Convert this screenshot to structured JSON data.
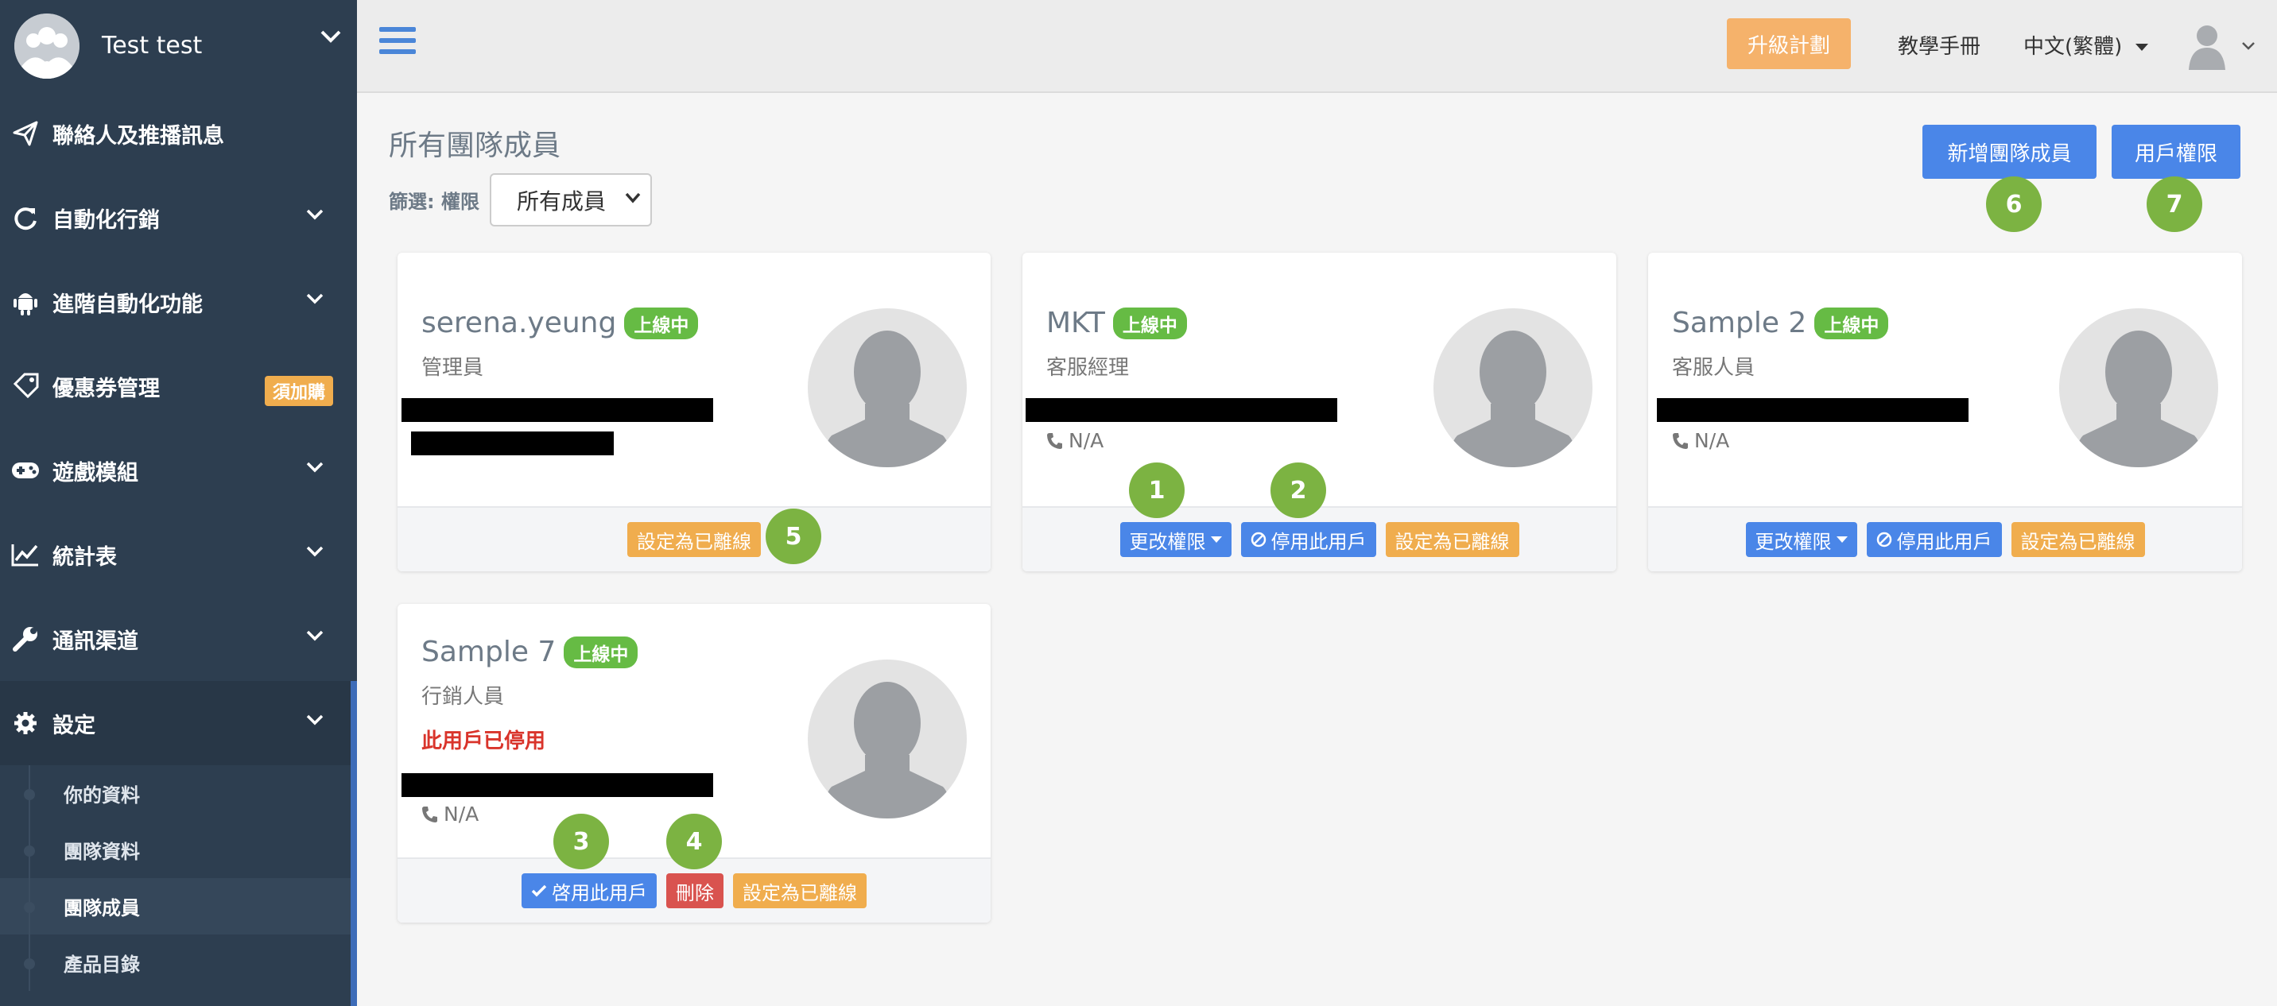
{
  "sidebar": {
    "user_name": "Test test",
    "items": [
      {
        "label": "聯絡人及推播訊息",
        "icon": "paper-plane-icon"
      },
      {
        "label": "自動化行銷",
        "icon": "refresh-icon"
      },
      {
        "label": "進階自動化功能",
        "icon": "android-icon"
      },
      {
        "label": "優惠券管理",
        "icon": "ticket-icon",
        "badge": "須加購"
      },
      {
        "label": "遊戲模組",
        "icon": "gamepad-icon"
      },
      {
        "label": "統計表",
        "icon": "line-chart-icon"
      },
      {
        "label": "通訊渠道",
        "icon": "wrench-icon"
      },
      {
        "label": "設定",
        "icon": "gear-icon"
      }
    ],
    "sub_items": [
      "你的資料",
      "團隊資料",
      "團隊成員",
      "產品目錄"
    ],
    "active_sub": "團隊成員"
  },
  "topbar": {
    "upgrade_label": "升級計劃",
    "manual_label": "教學手冊",
    "language_label": "中文(繁體)"
  },
  "main": {
    "title": "所有團隊成員",
    "filter_label": "篩選: 權限",
    "filter_value": "所有成員",
    "add_member_label": "新增團隊成員",
    "user_permission_label": "用戶權限"
  },
  "members": [
    {
      "name": "serena.yeung",
      "status": "上線中",
      "role": "管理員",
      "actions": [
        "設定為已離線"
      ]
    },
    {
      "name": "MKT",
      "status": "上線中",
      "role": "客服經理",
      "phone": "N/A",
      "actions": [
        "更改權限",
        "停用此用戶",
        "設定為已離線"
      ]
    },
    {
      "name": "Sample 2",
      "status": "上線中",
      "role": "客服人員",
      "phone": "N/A",
      "actions": [
        "更改權限",
        "停用此用戶",
        "設定為已離線"
      ]
    },
    {
      "name": "Sample 7",
      "status": "上線中",
      "role": "行銷人員",
      "disabled_note": "此用戶已停用",
      "phone": "N/A",
      "actions": [
        "啓用此用戶",
        "刪除",
        "設定為已離線"
      ]
    }
  ],
  "markers": [
    "1",
    "2",
    "3",
    "4",
    "5",
    "6",
    "7"
  ],
  "colors": {
    "sidebar": "#2d3e50",
    "primary": "#4a86e8",
    "warning": "#f0ad4e",
    "danger": "#d9534f",
    "success": "#66bb44",
    "marker": "#7cb342"
  }
}
